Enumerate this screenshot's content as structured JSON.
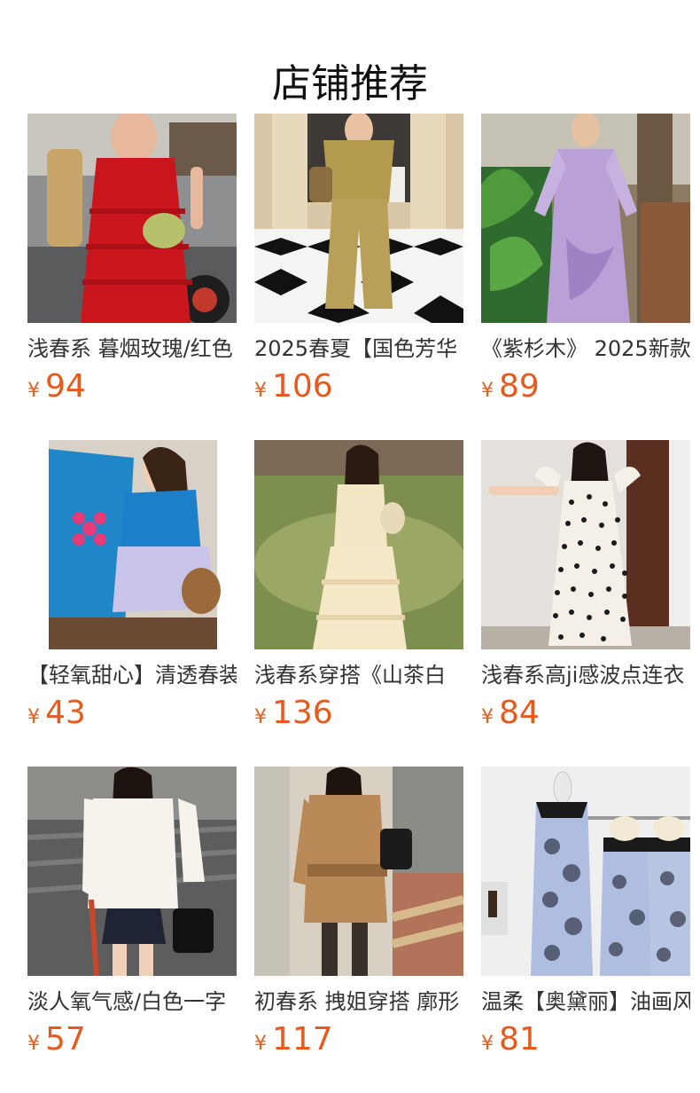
{
  "page": {
    "title": "店铺推荐",
    "currency_symbol": "¥"
  },
  "products": [
    {
      "title": "浅春系 暮烟玫瑰/红色",
      "price": "94",
      "image": "red ruffle dress photo"
    },
    {
      "title": "2025春夏【国色芳华",
      "price": "106",
      "image": "khaki wide-leg set photo"
    },
    {
      "title": "《紫杉木》 2025新款",
      "price": "89",
      "image": "lavender tie-dye dress photo"
    },
    {
      "title": "【轻氧甜心】清透春装",
      "price": "43",
      "image": "blue cardigan and skirt photo"
    },
    {
      "title": "浅春系穿搭《山茶白",
      "price": "136",
      "image": "cream tiered lace dress photo"
    },
    {
      "title": "浅春系高ji感波点连衣",
      "price": "84",
      "image": "polka dot dress photo"
    },
    {
      "title": "淡人氧气感/白色一字",
      "price": "57",
      "image": "white off-shoulder top photo"
    },
    {
      "title": "初春系 拽姐穿搭 廓形",
      "price": "117",
      "image": "camel trench blazer photo"
    },
    {
      "title": "温柔【奥黛丽】油画风",
      "price": "81",
      "image": "blue floral slip dress photo"
    }
  ]
}
